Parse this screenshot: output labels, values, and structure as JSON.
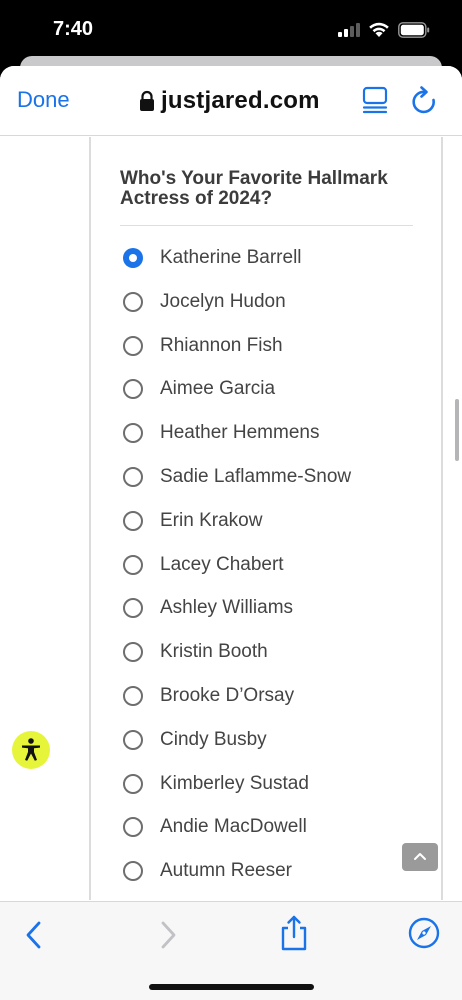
{
  "status_bar": {
    "time": "7:40",
    "icons": [
      "cellular-signal-icon",
      "wifi-icon",
      "battery-icon"
    ]
  },
  "nav": {
    "done_label": "Done",
    "url": "justjared.com",
    "icons": [
      "lock-icon",
      "reader-icon",
      "reload-icon"
    ]
  },
  "poll": {
    "title": "Who's Your Favorite Hallmark Actress of 2024?",
    "selected_index": 0,
    "options": [
      "Katherine Barrell",
      "Jocelyn Hudon",
      "Rhiannon Fish",
      "Aimee Garcia",
      "Heather Hemmens",
      "Sadie Laflamme-Snow",
      "Erin Krakow",
      "Lacey Chabert",
      "Ashley Williams",
      "Kristin Booth",
      "Brooke D’Orsay",
      "Cindy Busby",
      "Kimberley Sustad",
      "Andie MacDowell",
      "Autumn Reeser"
    ]
  },
  "overlay": {
    "accessibility_icon": "accessibility-person-icon",
    "scroll_top_icon": "chevron-up-icon"
  },
  "toolbar": {
    "icons": [
      "back-chevron-icon",
      "forward-chevron-icon",
      "share-icon",
      "compass-icon"
    ]
  },
  "colors": {
    "accent": "#1a73e8",
    "accessibility_badge": "#e6f53a",
    "text": "#444444",
    "title": "#3c3c3c"
  }
}
